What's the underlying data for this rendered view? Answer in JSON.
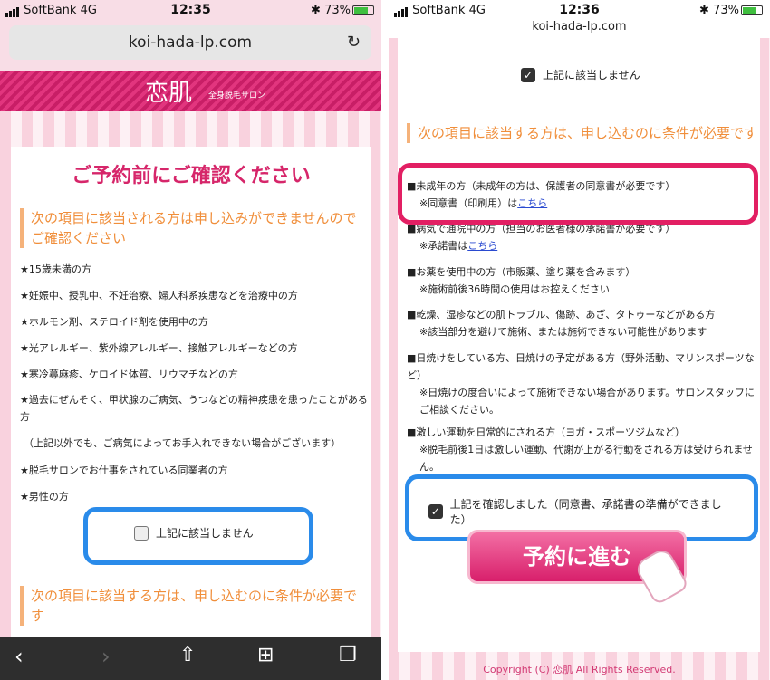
{
  "left": {
    "status": {
      "carrier": "SoftBank",
      "network": "4G",
      "time": "12:35",
      "battery": "73%"
    },
    "url": "koi-hada-lp.com",
    "brand": {
      "logo": "恋肌",
      "subtitle": "全身脱毛サロン"
    },
    "title": "ご予約前にご確認ください",
    "section1_heading": "次の項目に該当される方は申し込みができませんのでご確認ください",
    "items": [
      "★15歳未満の方",
      "★妊娠中、授乳中、不妊治療、婦人科系疾患などを治療中の方",
      "★ホルモン剤、ステロイド剤を使用中の方",
      "★光アレルギー、紫外線アレルギー、接触アレルギーなどの方",
      "★寒冷蕁麻疹、ケロイド体質、リウマチなどの方",
      "★過去にぜんそく、甲状腺のご病気、うつなどの精神疾患を患ったことがある方",
      "（上記以外でも、ご病気によってお手入れできない場合がございます）",
      "★脱毛サロンでお仕事をされている同業者の方",
      "★男性の方"
    ],
    "checkbox_label": "上記に該当しません",
    "section2_heading": "次の項目に該当する方は、申し込むのに条件が必要です"
  },
  "right": {
    "status": {
      "carrier": "SoftBank",
      "network": "4G",
      "time": "12:36",
      "battery": "73%"
    },
    "url": "koi-hada-lp.com",
    "checkbox_top_label": "上記に該当しません",
    "section_heading": "次の項目に該当する方は、申し込むのに条件が必要です",
    "items": [
      {
        "main": "■未成年の方（未成年の方は、保護者の同意書が必要です）",
        "sub": "※同意書（印刷用）は",
        "link": "こちら"
      },
      {
        "main": "■病気で通院中の方（担当のお医者様の承諾書が必要です）",
        "sub": "※承諾書は",
        "link": "こちら"
      },
      {
        "main": "■お薬を使用中の方（市販薬、塗り薬を含みます）",
        "sub": "※施術前後36時間の使用はお控えください",
        "link": ""
      },
      {
        "main": "■乾燥、湿疹などの肌トラブル、傷跡、あざ、タトゥーなどがある方",
        "sub": "※該当部分を避けて施術、または施術できない可能性があります",
        "link": ""
      },
      {
        "main": "■日焼けをしている方、日焼けの予定がある方（野外活動、マリンスポーツなど）",
        "sub": "※日焼けの度合いによって施術できない場合があります。サロンスタッフにご相談ください。",
        "link": ""
      },
      {
        "main": "■激しい運動を日常的にされる方（ヨガ・スポーツジムなど）",
        "sub": "※脱毛前後1日は激しい運動、代謝が上がる行動をされる方は受けられません。",
        "link": ""
      }
    ],
    "confirm_label": "上記を確認しました（同意書、承諾書の準備ができました）",
    "reserve_button": "予約に進む",
    "copyright": "Copyright (C) 恋肌 All Rights Reserved."
  }
}
